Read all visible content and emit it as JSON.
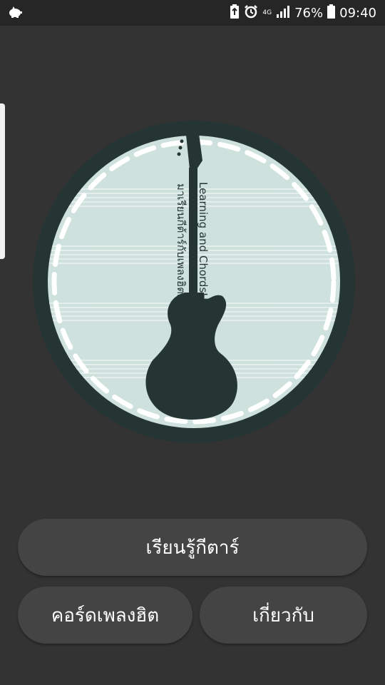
{
  "status_bar": {
    "battery_percent": "76%",
    "time": "09:40",
    "network": "4G",
    "icons": [
      "piggy-bank-icon",
      "battery-saver-icon",
      "alarm-icon",
      "signal-icon",
      "battery-icon"
    ]
  },
  "logo": {
    "line1": "Learning and ChordsHit",
    "line2": "มาเรียนกีต้าร์กับเพลงฮิตกันเถอะ"
  },
  "buttons": {
    "learn_guitar": "เรียนรู้กีตาร์",
    "hit_chords": "คอร์ดเพลงฮิต",
    "about": "เกี่ยวกับ"
  },
  "colors": {
    "background": "#333333",
    "status_bar": "#262626",
    "button": "#444444",
    "logo_fill": "#cfe1dc",
    "logo_dark": "#243533"
  }
}
